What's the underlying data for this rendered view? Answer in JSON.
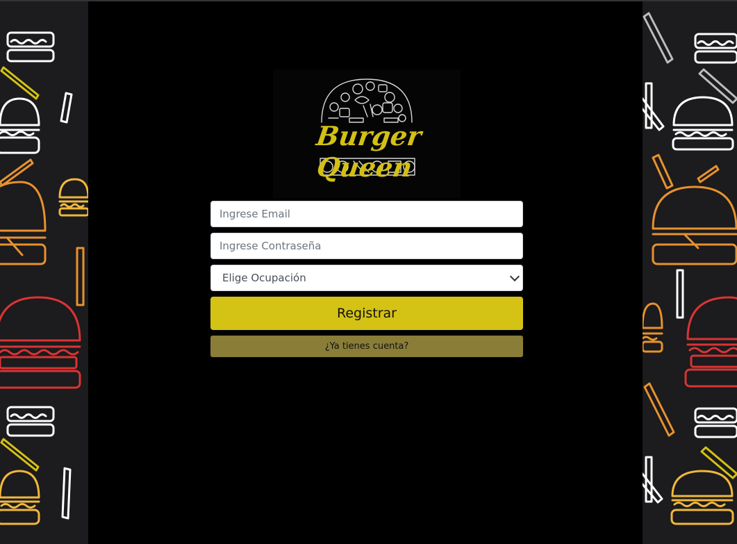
{
  "brand": {
    "name": "Burger Queen"
  },
  "form": {
    "email_placeholder": "Ingrese Email",
    "password_placeholder": "Ingrese Contraseña",
    "occupation_selected": "Elige Ocupación",
    "register_label": "Registrar",
    "have_account_label": "¿Ya tienes cuenta?"
  },
  "colors": {
    "accent": "#d4c215",
    "secondary": "#897d38",
    "side_background": "#1c1b1d",
    "burger_white": "#ffffff",
    "burger_orange": "#e8922e",
    "burger_red": "#d93434",
    "burger_yellow": "#f0b83c"
  },
  "icons": [
    "burger-icon",
    "fries-icon",
    "food-collage-icon"
  ]
}
